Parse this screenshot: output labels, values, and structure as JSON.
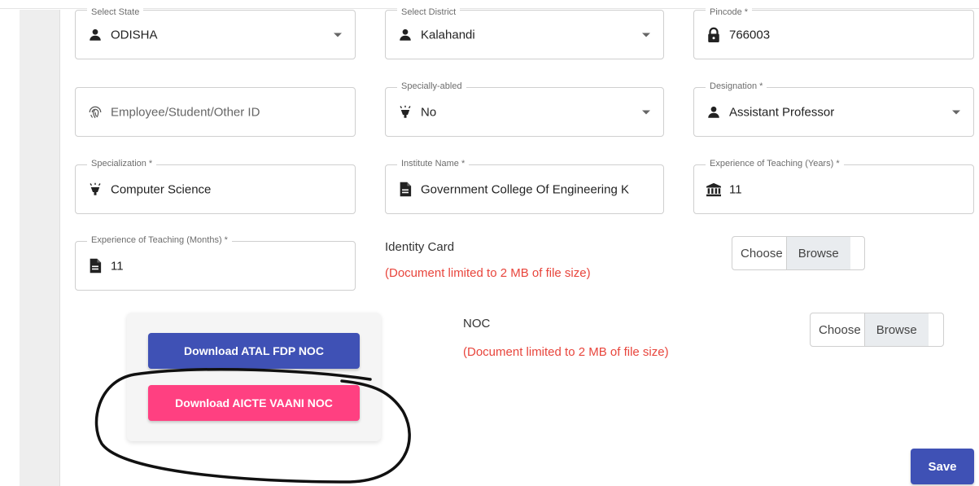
{
  "form": {
    "state": {
      "label": "Select State",
      "value": "ODISHA",
      "icon": "person-icon"
    },
    "district": {
      "label": "Select District",
      "value": "Kalahandi",
      "icon": "person-icon"
    },
    "pincode": {
      "label": "Pincode *",
      "value": "766003",
      "icon": "lock-icon"
    },
    "employee_id": {
      "placeholder": "Employee/Student/Other ID",
      "icon": "fingerprint-icon"
    },
    "specially_abled": {
      "label": "Specially-abled",
      "value": "No",
      "icon": "lamp-icon"
    },
    "designation": {
      "label": "Designation *",
      "value": "Assistant Professor",
      "icon": "person-icon"
    },
    "specialization": {
      "label": "Specialization *",
      "value": "Computer Science",
      "icon": "lamp-icon"
    },
    "institute": {
      "label": "Institute Name *",
      "value": "Government College Of Engineering K",
      "icon": "document-icon"
    },
    "exp_years": {
      "label": "Experience of Teaching (Years) *",
      "value": "11",
      "icon": "institution-icon"
    },
    "exp_months": {
      "label": "Experience of Teaching (Months) *",
      "value": "11",
      "icon": "document-icon"
    }
  },
  "identity_card": {
    "label": "Identity Card",
    "hint": "(Document limited to 2 MB of file size)",
    "choose": "Choose",
    "browse": "Browse"
  },
  "noc": {
    "label": "NOC",
    "hint": "(Document limited to 2 MB of file size)",
    "choose": "Choose",
    "browse": "Browse"
  },
  "buttons": {
    "atal": "Download ATAL FDP NOC",
    "aicte": "Download AICTE VAANI NOC",
    "save": "Save"
  },
  "colors": {
    "primary": "#3f51b5",
    "accent": "#ff4081",
    "hint": "#e8453c"
  }
}
